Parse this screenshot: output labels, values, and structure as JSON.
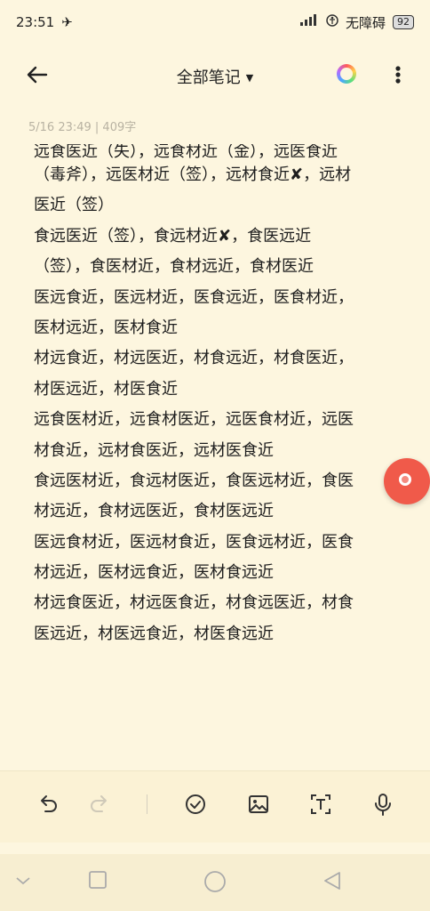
{
  "status": {
    "time": "23:51",
    "accessibility": "无障碍",
    "battery": "92"
  },
  "appbar": {
    "title": "全部笔记"
  },
  "note": {
    "meta": "5/16 23:49 | 409字",
    "partial_line": "远食医近（失），远食材近（金），远医食近",
    "lines": [
      "（毒斧），远医材近（签），远材食近✘，远材",
      "医近（签）",
      "食远医近（签），食远材近✘，食医远近",
      "（签），食医材近，食材远近，食材医近",
      "医远食近，医远材近，医食远近，医食材近，",
      "医材远近，医材食近",
      "材远食近，材远医近，材食远近，材食医近，",
      "材医远近，材医食近",
      "远食医材近，远食材医近，远医食材近，远医",
      "材食近，远材食医近，远材医食近",
      "食远医材近，食远材医近，食医远材近，食医",
      "材远近，食材远医近，食材医远近",
      "医远食材近，医远材食近，医食远材近，医食",
      "材远近，医材远食近，医材食远近",
      "材远食医近，材远医食近，材食远医近，材食",
      "医远近，材医远食近，材医食远近"
    ]
  }
}
